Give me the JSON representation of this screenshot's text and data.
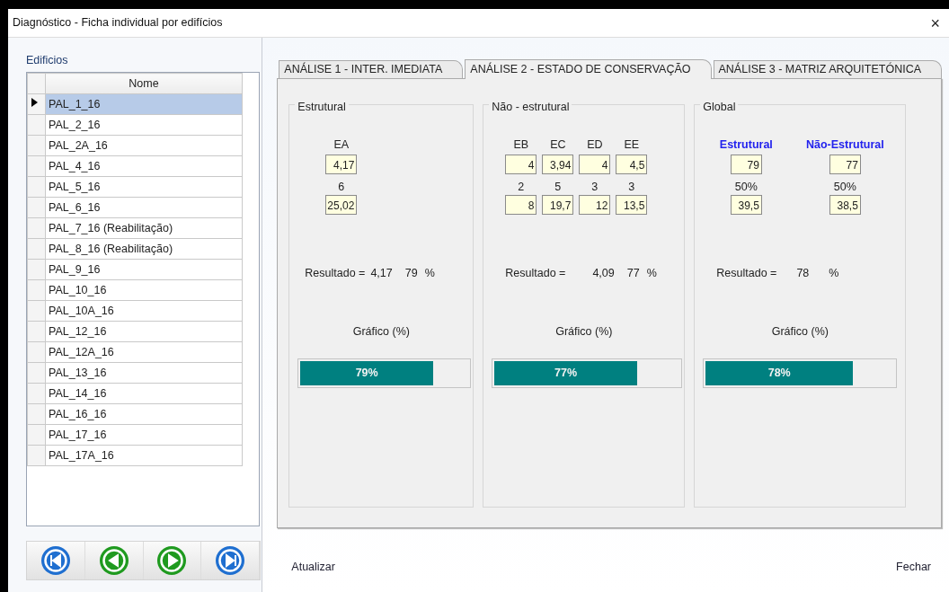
{
  "window": {
    "title": "Diagnóstico - Ficha individual por edifícios",
    "close": "×"
  },
  "sidebar": {
    "title": "Edificios",
    "columns": [
      "Nome"
    ],
    "rows": [
      {
        "name": "PAL_1_16",
        "selected": true
      },
      {
        "name": "PAL_2_16",
        "selected": false
      },
      {
        "name": "PAL_2A_16",
        "selected": false
      },
      {
        "name": "PAL_4_16",
        "selected": false
      },
      {
        "name": "PAL_5_16",
        "selected": false
      },
      {
        "name": "PAL_6_16",
        "selected": false
      },
      {
        "name": "PAL_7_16 (Reabilitação)",
        "selected": false
      },
      {
        "name": "PAL_8_16 (Reabilitação)",
        "selected": false
      },
      {
        "name": "PAL_9_16",
        "selected": false
      },
      {
        "name": "PAL_10_16",
        "selected": false
      },
      {
        "name": "PAL_10A_16",
        "selected": false
      },
      {
        "name": "PAL_12_16",
        "selected": false
      },
      {
        "name": "PAL_12A_16",
        "selected": false
      },
      {
        "name": "PAL_13_16",
        "selected": false
      },
      {
        "name": "PAL_14_16",
        "selected": false
      },
      {
        "name": "PAL_16_16",
        "selected": false
      },
      {
        "name": "PAL_17_16",
        "selected": false
      },
      {
        "name": "PAL_17A_16",
        "selected": false
      }
    ],
    "navigator": [
      {
        "kind": "first"
      },
      {
        "kind": "previous"
      },
      {
        "kind": "next"
      },
      {
        "kind": "last"
      }
    ]
  },
  "tabs": [
    {
      "label": "ANÁLISE 1 - INTER. IMEDIATA",
      "selected": false
    },
    {
      "label": "ANÁLISE 2 - ESTADO DE CONSERVAÇÃO",
      "selected": true
    },
    {
      "label": "ANÁLISE 3 - MATRIZ ARQUITETÓNICA",
      "selected": false
    }
  ],
  "groups": [
    {
      "kind": "partial",
      "title": "Estrutural",
      "columns": [
        {
          "header": "EA",
          "value": "4,17",
          "weight": "6",
          "weighted": "25,02"
        }
      ],
      "result_label": "Resultado =",
      "result_value": "4,17",
      "result_percent": "79",
      "result_unit": "%",
      "chart_label": "Gráfico (%)",
      "level": 0.79,
      "bar_text": "79%"
    },
    {
      "kind": "partial",
      "title": "Não - estrutural",
      "columns": [
        {
          "header": "EB",
          "value": "4",
          "weight": "2",
          "weighted": "8"
        },
        {
          "header": "EC",
          "value": "3,94",
          "weight": "5",
          "weighted": "19,7"
        },
        {
          "header": "ED",
          "value": "4",
          "weight": "3",
          "weighted": "12"
        },
        {
          "header": "EE",
          "value": "4,5",
          "weight": "3",
          "weighted": "13,5"
        }
      ],
      "result_label": "Resultado =",
      "result_value": "4,09",
      "result_percent": "77",
      "result_unit": "%",
      "chart_label": "Gráfico (%)",
      "level": 0.77,
      "bar_text": "77%"
    },
    {
      "kind": "global",
      "title": "Global",
      "columns": [
        {
          "header": "Estrutural",
          "value": "79",
          "weight": "50%",
          "weighted": "39,5"
        },
        {
          "header": "Não-Estrutural",
          "value": "77",
          "weight": "50%",
          "weighted": "38,5"
        }
      ],
      "result_label": "Resultado =",
      "result_percent": "78",
      "result_unit": "%",
      "chart_label": "Gráfico (%)",
      "level": 0.78,
      "bar_text": "78%"
    }
  ],
  "footer": {
    "refresh": "Atualizar",
    "close": "Fechar"
  }
}
